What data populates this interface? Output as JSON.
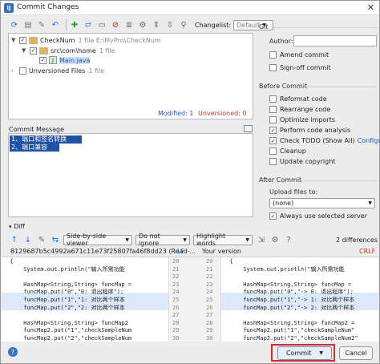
{
  "window": {
    "title": "Commit Changes",
    "close": "✕"
  },
  "toolbar": {
    "icons": [
      "refresh-icon",
      "diff-icon",
      "edit-icon",
      "revert-icon",
      "move-icon",
      "add-icon",
      "shelve-icon",
      "ignore-icon",
      "expand-icon",
      "collapse-icon",
      "group-icon",
      "settings-icon",
      "sort-icon",
      "filter-icon"
    ],
    "changelist_label": "Changelist:",
    "changelist_value": "Default"
  },
  "tree": {
    "root_label": "CheckNum",
    "root_meta": "1 file  E:\\MyPro\\CheckNum",
    "pkg_label": "src\\com\\home",
    "pkg_meta": "1 file",
    "file_label": "Main.java",
    "unversioned_label": "Unversioned Files",
    "unversioned_meta": "1 file"
  },
  "status": {
    "modified": "Modified: 1",
    "unversioned": "Unversioned: 0",
    "unversioned_extra": "1"
  },
  "commit_message": {
    "label": "Commit Message",
    "lines": [
      "1、端口和签名转换",
      "2、端口兼容"
    ]
  },
  "git": {
    "section": "Git",
    "author_label": "Author:",
    "author_value": "",
    "amend": "Amend commit",
    "signoff": "Sign-off commit",
    "before_commit": "Before Commit",
    "reformat": "Reformat code",
    "rearrange": "Rearrange code",
    "optimize": "Optimize imports",
    "analysis": "Perform code analysis",
    "todo": "Check TODO (Show All)",
    "todo_link": "Configure",
    "cleanup": "Cleanup",
    "copyright": "Update copyright",
    "after_commit": "After Commit",
    "upload_label": "Upload files to:",
    "upload_value": "(none)",
    "always_use": "Always use selected server"
  },
  "diff": {
    "label": "Diff",
    "viewer": "Side-by-side viewer",
    "ignore": "Do not ignore",
    "highlight": "Highlight words",
    "differences": "2 differences",
    "hash": "8129687b5c4992a671c11e73f25807fa46f8dd23 (Read-...",
    "left_sep": "LF",
    "your_version": "Your version",
    "right_sep": "CRLF",
    "left_lines": [
      "  {",
      "      System.out.println(\"输入所需功能",
      "",
      "      HashMap<String,String> funcMap =",
      "      funcMap.put(\"0\",\"0: 退出程序\");",
      "      funcMap.put(\"1\",\"1: 对比两个样本",
      "      funcMap.put(\"2\",\"2: 对比两个样本",
      "",
      "      HashMap<String,String> funcMap2",
      "      funcMap2.put(\"1\",\"checkSampleNum",
      "      funcMap2.put(\"2\",\"checkSampleNum"
    ],
    "right_lines": [
      "  {",
      "      System.out.println(\"输入所需功能",
      "",
      "      HashMap<String,String> funcMap =",
      "      funcMap.put(\"0\",\"-> 0: 退出程序\");",
      "      funcMap.put(\"1\",\"-> 1: 对比两个样本",
      "      funcMap.put(\"2\",\"-> 2: 对比两个样本",
      "",
      "      HashMap<String,String> funcMap2 =",
      "      funcMap2.put(\"1\",\"checkSampleNum\"",
      "      funcMap2.put(\"2\",\"checkSampleNum2\""
    ],
    "left_numbers": [
      "20",
      "21",
      "22",
      "23",
      "24",
      "25",
      "26",
      "27",
      "28",
      "29",
      "30"
    ],
    "right_numbers": [
      "20",
      "21",
      "22",
      "23",
      "24",
      "25",
      "26",
      "27",
      "28",
      "29",
      "30"
    ]
  },
  "buttons": {
    "help": "?",
    "commit": "Commit",
    "cancel": "Cancel"
  }
}
